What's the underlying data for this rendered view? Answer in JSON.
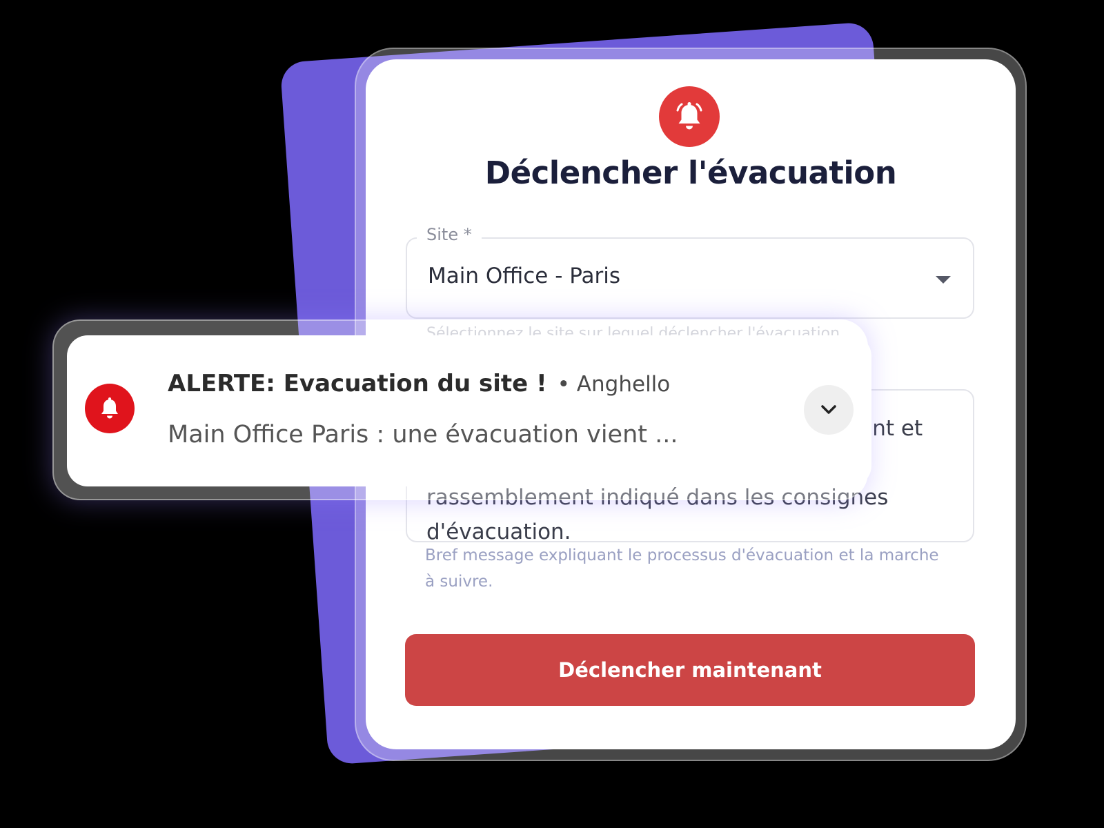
{
  "card": {
    "icon": "alarm-bell-icon",
    "title": "Déclencher l'évacuation",
    "site_label": "Site *",
    "site_value": "Main Office - Paris",
    "site_helper": "Sélectionnez le site sur lequel déclencher l'évacuation.",
    "message_value": "Veuillez quitter le bâtiment immédiatement et rester calme. Rendez-vous au point de rassemblement indiqué dans les consignes d'évacuation.",
    "message_helper": "Bref message expliquant le processus d'évacuation et la marche à suivre.",
    "trigger_button_label": "Déclencher maintenant"
  },
  "notification": {
    "icon": "bell-icon",
    "title": "ALERTE: Evacuation du site !",
    "sender": "• Anghello",
    "body": "Main Office Paris : une évacuation vient ...",
    "expand_icon": "chevron-down-icon"
  },
  "colors": {
    "background": "#000000",
    "backdrop_purple": "#6c5bd9",
    "alert_red": "#e23a3a",
    "button_red": "#cc4545",
    "title_dark": "#1b1f3b"
  }
}
